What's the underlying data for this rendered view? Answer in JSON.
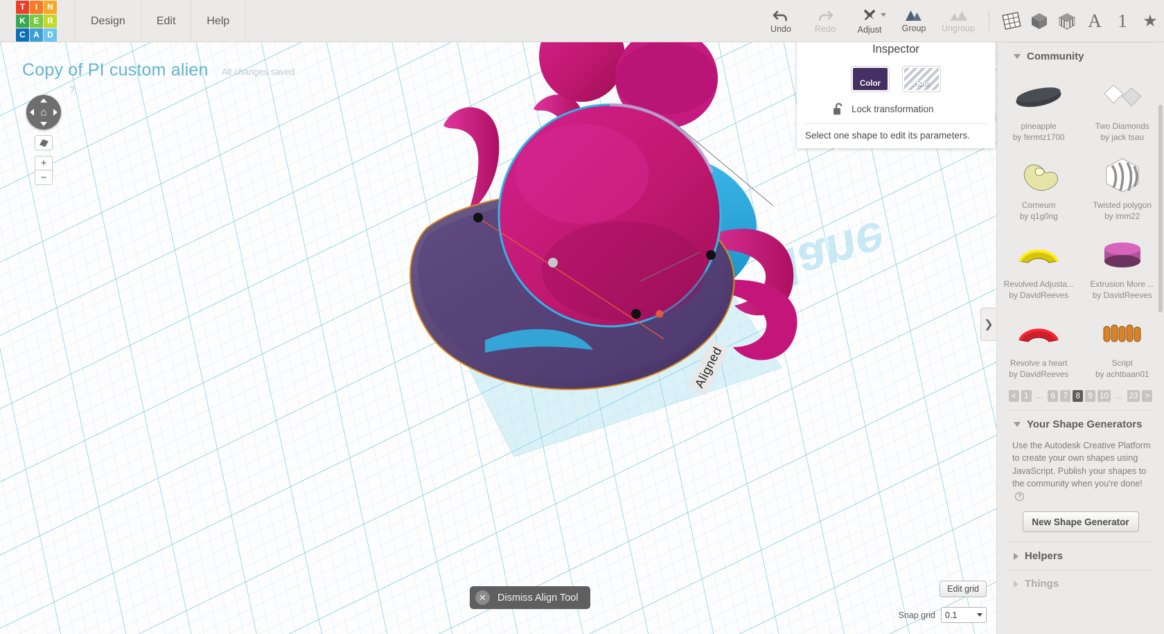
{
  "app": {
    "logo_letters": [
      {
        "ch": "T",
        "color": "#ed3e28"
      },
      {
        "ch": "I",
        "color": "#f77b25"
      },
      {
        "ch": "N",
        "color": "#f9a826"
      },
      {
        "ch": "K",
        "color": "#36a852"
      },
      {
        "ch": "E",
        "color": "#7ac943"
      },
      {
        "ch": "R",
        "color": "#c3d92a"
      },
      {
        "ch": "C",
        "color": "#0e6eb8"
      },
      {
        "ch": "A",
        "color": "#3d9fd8"
      },
      {
        "ch": "D",
        "color": "#6cc4ee"
      }
    ],
    "menu": [
      "Design",
      "Edit",
      "Help"
    ]
  },
  "toolbar": {
    "undo": "Undo",
    "redo": "Redo",
    "adjust": "Adjust",
    "group": "Group",
    "ungroup": "Ungroup",
    "view_icons": [
      "workplane-icon",
      "cube-icon",
      "ruler-cube-icon",
      "text-icon",
      "number-icon",
      "star-icon"
    ],
    "text_glyph": "A",
    "number_glyph": "1",
    "star_glyph": "★"
  },
  "canvas": {
    "doc_title": "Copy of PI custom alien",
    "save_status": "All changes saved",
    "nav_help": "?",
    "aligned_label": "Aligned",
    "zoom_in": "+",
    "zoom_out": "−",
    "home_glyph": "⌂"
  },
  "inspector": {
    "title": "Inspector",
    "color_label": "Color",
    "color_value": "#453064",
    "hole_label": "Hole",
    "lock_label": "Lock transformation",
    "note": "Select one shape to edit its parameters.",
    "help": "?"
  },
  "bottom": {
    "dismiss_label": "Dismiss Align Tool",
    "dismiss_x": "✕",
    "edit_grid": "Edit grid",
    "snap_label": "Snap grid",
    "snap_value": "0.1"
  },
  "panel_handle": "❯",
  "right_panel": {
    "community": {
      "title": "Community",
      "shapes": [
        {
          "name": "pineapple",
          "author": "by fermtz1700",
          "color": "#3b3f44",
          "kind": "flat-disc"
        },
        {
          "name": "Two Diamonds",
          "author": "by jack tsau",
          "color": "#dcdcdc",
          "kind": "diamonds"
        },
        {
          "name": "Corneum",
          "author": "by q1g0ng",
          "color": "#e6e4a8",
          "kind": "bean"
        },
        {
          "name": "Twisted polygon",
          "author": "by imm22",
          "color": "#d9d9d9",
          "kind": "twisted"
        },
        {
          "name": "Revolved Adjusta...",
          "author": "by DavidReeves",
          "color": "#d4c310",
          "kind": "arc"
        },
        {
          "name": "Extrusion More ...",
          "author": "by DavidReeves",
          "color": "#b0529b",
          "kind": "cylinder"
        },
        {
          "name": "Revolve a heart",
          "author": "by DavidReeves",
          "color": "#cc1f2b",
          "kind": "arc"
        },
        {
          "name": "Script",
          "author": "by achtbaan01",
          "color": "#d98326",
          "kind": "ridges"
        }
      ],
      "pagination": {
        "prev": "<",
        "next": ">",
        "pages": [
          "1",
          "…",
          "6",
          "7",
          "8",
          "9",
          "10",
          "…",
          "23"
        ],
        "active": "8"
      }
    },
    "generators": {
      "title": "Your Shape Generators",
      "description": "Use the Autodesk Creative Platform to create your own shapes using JavaScript. Publish your shapes to the community when you're done!",
      "help": "?",
      "button": "New Shape Generator"
    },
    "helpers": {
      "title": "Helpers"
    },
    "things": {
      "title": "Things"
    }
  }
}
